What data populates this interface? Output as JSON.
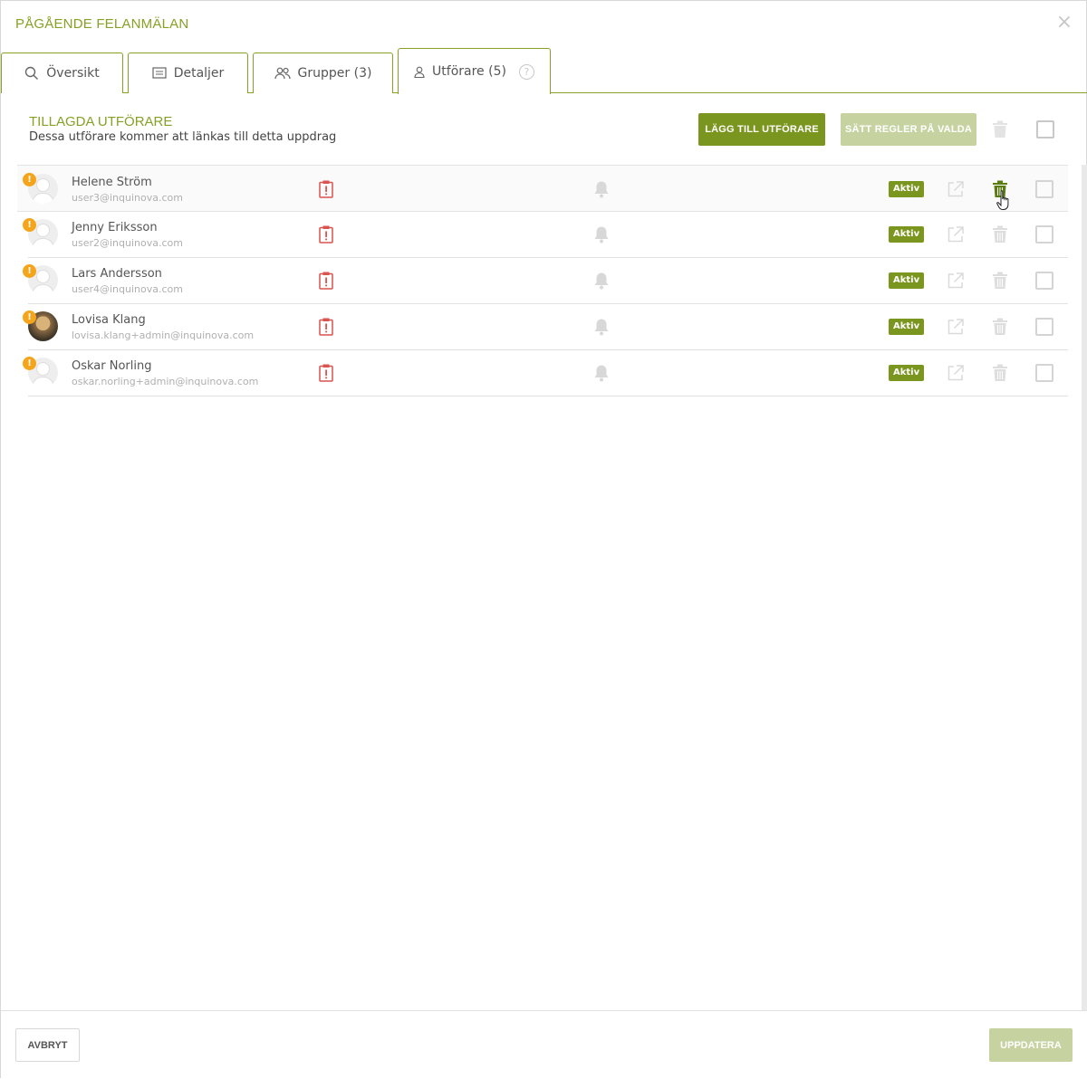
{
  "dialog": {
    "title": "PÅGÅENDE FELANMÄLAN",
    "close_label": "×"
  },
  "tabs": [
    {
      "label": "Översikt",
      "icon": "search-icon"
    },
    {
      "label": "Detaljer",
      "icon": "details-icon"
    },
    {
      "label": "Grupper (3)",
      "icon": "group-icon"
    },
    {
      "label": "Utförare (5)",
      "icon": "user-icon",
      "active": true,
      "help": "?"
    }
  ],
  "section": {
    "title": "TILLAGDA UTFÖRARE",
    "subtitle": "Dessa utförare kommer att länkas till detta uppdrag",
    "add_button": "LÄGG TILL UTFÖRARE",
    "rules_button": "SÄTT REGLER PÅ VALDA"
  },
  "performers": [
    {
      "name": "Helene Ström",
      "email": "user3@inquinova.com",
      "status": "Aktiv",
      "warning": "!"
    },
    {
      "name": "Jenny Eriksson",
      "email": "user2@inquinova.com",
      "status": "Aktiv",
      "warning": "!"
    },
    {
      "name": "Lars Andersson",
      "email": "user4@inquinova.com",
      "status": "Aktiv",
      "warning": "!"
    },
    {
      "name": "Lovisa Klang",
      "email": "lovisa.klang+admin@inquinova.com",
      "status": "Aktiv",
      "warning": "!"
    },
    {
      "name": "Oskar Norling",
      "email": "oskar.norling+admin@inquinova.com",
      "status": "Aktiv",
      "warning": "!"
    }
  ],
  "footer": {
    "cancel": "AVBRYT",
    "update": "UPPDATERA"
  },
  "colors": {
    "accent": "#7b961f",
    "title": "#86a126",
    "warning": "#f4a51c",
    "danger": "#d9534f",
    "disabled": "#c6d3a1"
  }
}
